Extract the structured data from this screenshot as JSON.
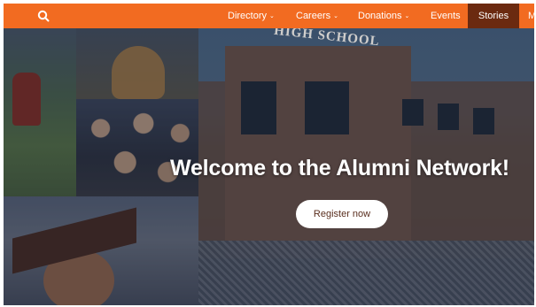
{
  "nav": {
    "items": [
      {
        "label": "Directory",
        "dropdown": true
      },
      {
        "label": "Careers",
        "dropdown": true
      },
      {
        "label": "Donations",
        "dropdown": true
      },
      {
        "label": "Events",
        "dropdown": false
      },
      {
        "label": "Stories",
        "dropdown": false,
        "active": true
      },
      {
        "label": "M",
        "dropdown": false
      }
    ]
  },
  "hero": {
    "school_sign": "HIGH SCHOOL",
    "headline": "Welcome to the Alumni Network!",
    "register_label": "Register now"
  },
  "colors": {
    "accent": "#f26b21",
    "active_nav": "#6b2a10"
  }
}
